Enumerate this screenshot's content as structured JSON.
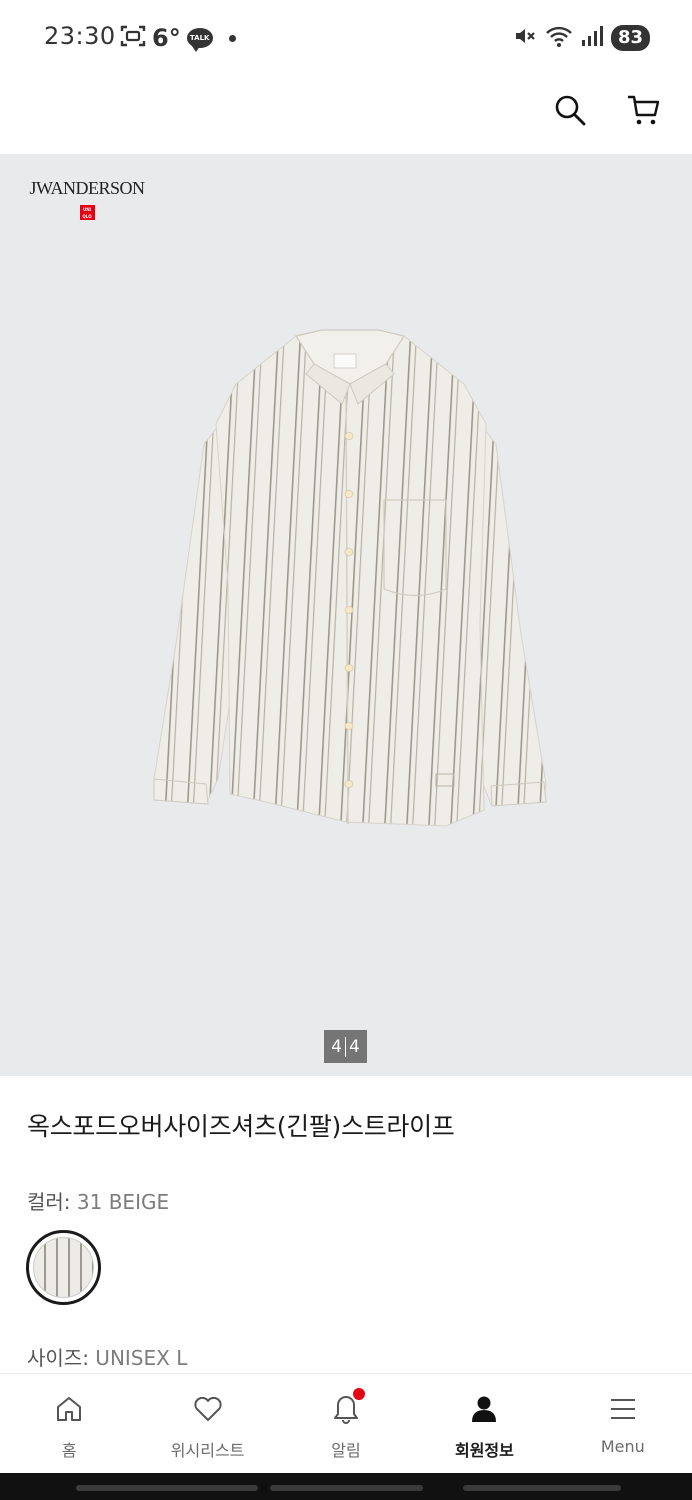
{
  "status_bar": {
    "time": "23:30",
    "temperature": "6°",
    "talk_label": "TALK",
    "battery": "83"
  },
  "header": {
    "search_icon": "search-icon",
    "cart_icon": "cart-icon"
  },
  "gallery": {
    "brand": "JWANDERSON",
    "sub_brand_logo": "UNIQLO",
    "page_current": "4",
    "page_total": "4"
  },
  "product": {
    "title": "옥스포드오버사이즈셔츠(긴팔)스트라이프",
    "color_label": "컬러:",
    "color_value": " 31 BEIGE",
    "size_label": "사이즈:",
    "size_value": " UNISEX L"
  },
  "bottom_nav": {
    "items": [
      {
        "label": "홈",
        "icon": "home-icon"
      },
      {
        "label": "위시리스트",
        "icon": "heart-icon"
      },
      {
        "label": "알림",
        "icon": "bell-icon"
      },
      {
        "label": "회원정보",
        "icon": "user-icon"
      },
      {
        "label": "Menu",
        "icon": "menu-icon"
      }
    ]
  },
  "colors": {
    "accent": "#e60012",
    "gallery_bg": "#e9eaec"
  }
}
